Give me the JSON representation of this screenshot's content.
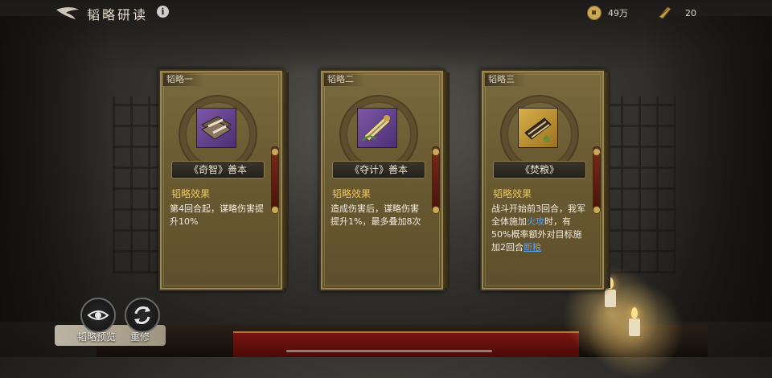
{
  "header": {
    "title": "韬略研读",
    "info_label": "i"
  },
  "resources": {
    "coins": "49万",
    "scrolls": "20"
  },
  "cards": [
    {
      "tab": "韬略一",
      "name": "《奇智》善本",
      "effect_label": "韬略效果",
      "desc": "第4回合起，谋略伤害提升10%",
      "icon": "book-bundle-icon",
      "icon_color": "purple"
    },
    {
      "tab": "韬略二",
      "name": "《夺计》善本",
      "effect_label": "韬略效果",
      "desc": "造成伤害后，谋略伤害提升1%，最多叠加8次",
      "icon": "scroll-bundle-icon",
      "icon_color": "purple"
    },
    {
      "tab": "韬略三",
      "name": "《焚粮》",
      "effect_label": "韬略效果",
      "desc_parts": [
        "战斗开始前3回合，我军全体施加",
        "火攻",
        "时，有50%概率额外对目标施加2回合",
        "断粮"
      ],
      "icon": "burning-scroll-icon",
      "icon_color": "gold"
    }
  ],
  "buttons": {
    "preview_label": "韬略预览",
    "reforge_label": "重修"
  },
  "colors": {
    "accent_gold": "#ecc55a",
    "link_blue": "#5b9ff0"
  }
}
